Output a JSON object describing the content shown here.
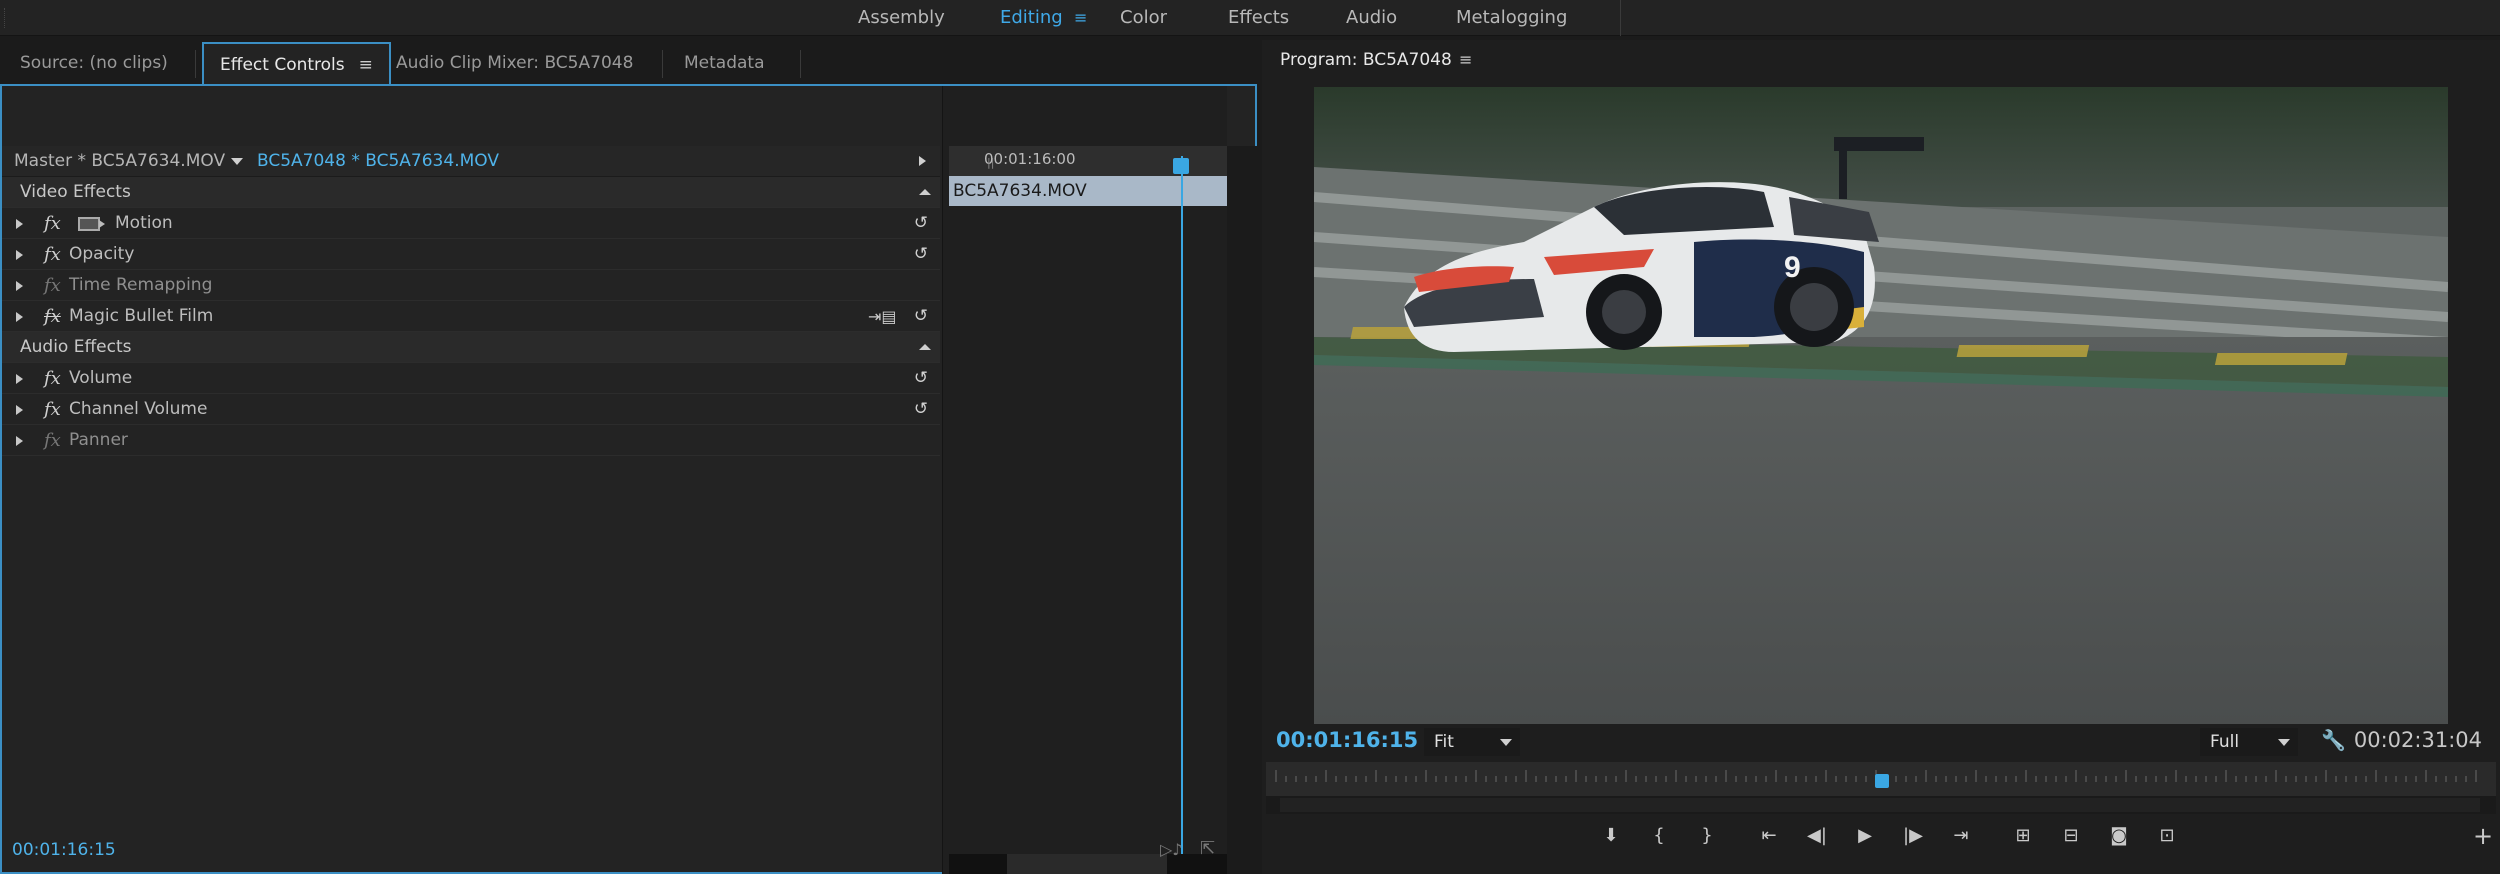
{
  "workspaces": {
    "items": [
      {
        "label": "Assembly",
        "active": false
      },
      {
        "label": "Editing",
        "active": true
      },
      {
        "label": "Color",
        "active": false
      },
      {
        "label": "Effects",
        "active": false
      },
      {
        "label": "Audio",
        "active": false
      },
      {
        "label": "Metalogging",
        "active": false
      }
    ],
    "menu_glyph": "≡"
  },
  "left_panel": {
    "tabs": [
      {
        "label": "Source: (no clips)"
      },
      {
        "label": "Effect Controls",
        "active": true
      },
      {
        "label": "Audio Clip Mixer: BC5A7048"
      },
      {
        "label": "Metadata"
      }
    ],
    "tab_menu_glyph": "≡",
    "master_label": "Master * BC5A7634.MOV",
    "sequence_clip_label": "BC5A7048 * BC5A7634.MOV",
    "video_effects_label": "Video Effects",
    "audio_effects_label": "Audio Effects",
    "video_effects": [
      {
        "label": "Motion"
      },
      {
        "label": "Opacity"
      },
      {
        "label": "Time Remapping"
      },
      {
        "label": "Magic Bullet Film"
      }
    ],
    "audio_effects": [
      {
        "label": "Volume"
      },
      {
        "label": "Channel Volume"
      },
      {
        "label": "Panner"
      }
    ],
    "fx_glyph": "fx",
    "timeline_timecode": "00:01:16:00",
    "clip_name": "BC5A7634.MOV",
    "current_timecode": "00:01:16:15"
  },
  "program": {
    "title": "Program: BC5A7048",
    "menu_glyph": "≡",
    "current_timecode": "00:01:16:15",
    "duration_timecode": "00:02:31:04",
    "zoom": "Fit",
    "resolution": "Full",
    "playhead_position": 0.505,
    "colors": {
      "accent": "#3aa7e3",
      "panel_border": "#3b8fc4"
    }
  }
}
